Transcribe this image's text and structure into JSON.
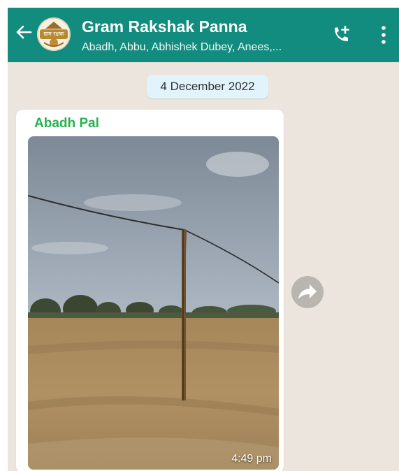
{
  "header": {
    "title": "Gram Rakshak Panna",
    "subtitle": "Abadh, Abbu, Abhishek Dubey, Anees,...",
    "avatar_text": "ग्राम रक्षक",
    "back_icon": "arrow-left-icon",
    "call_icon": "add-call-icon",
    "menu_icon": "more-vertical-icon"
  },
  "chat": {
    "date_chip": "4 December 2022",
    "message": {
      "sender": "Abadh Pal",
      "time": "4:49 pm",
      "image_subject": "wooden pole in dry field",
      "forward_icon": "forward-icon"
    }
  },
  "colors": {
    "header": "#128c7e",
    "sender": "#25b34c",
    "chat_background": "#ece5dd",
    "date_chip": "#e1f3fb"
  }
}
